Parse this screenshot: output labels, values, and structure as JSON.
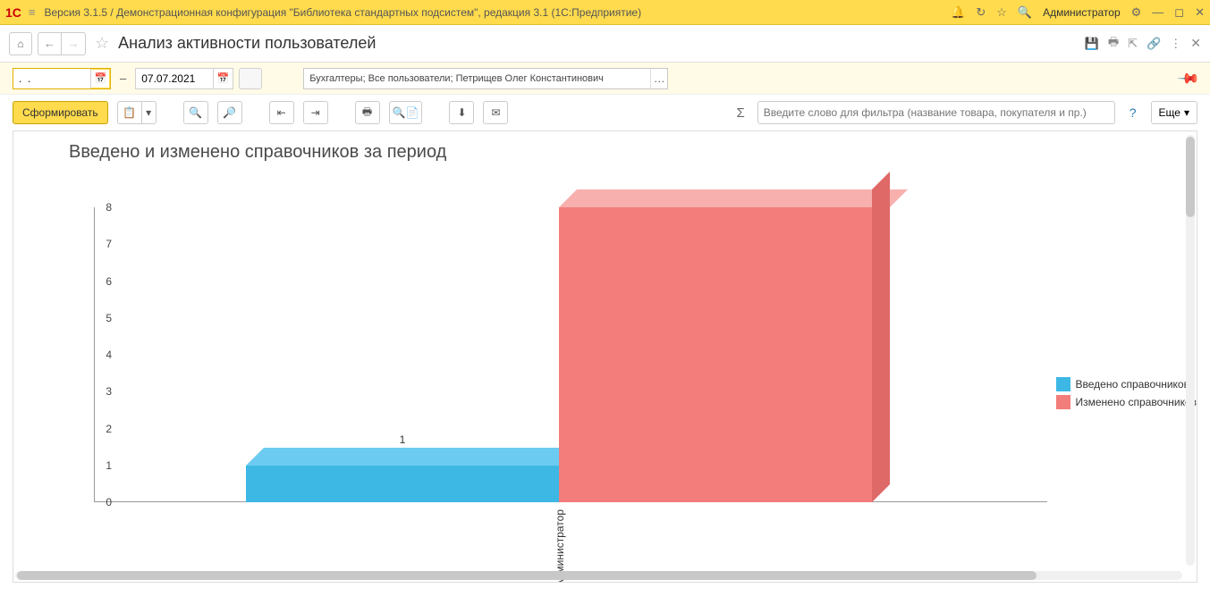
{
  "appbar": {
    "logo": "1С",
    "title": "Версия 3.1.5 / Демонстрационная конфигурация \"Библиотека стандартных подсистем\", редакция 3.1  (1С:Предприятие)",
    "user": "Администратор"
  },
  "page": {
    "title": "Анализ активности пользователей"
  },
  "filter": {
    "date_from": ".  .",
    "date_to": "07.07.2021",
    "dash": "–",
    "users": "Бухгалтеры; Все пользователи; Петрищев Олег Константинович"
  },
  "toolbar": {
    "generate": "Сформировать",
    "filter_placeholder": "Введите слово для фильтра (название товара, покупателя и пр.)",
    "more": "Еще",
    "help": "?"
  },
  "chart_data": {
    "type": "bar",
    "title": "Введено и изменено справочников за период",
    "categories": [
      "Администратор"
    ],
    "series": [
      {
        "name": "Введено справочников",
        "values": [
          1
        ],
        "color": "#3db8e5",
        "colorTop": "#6ccbf0",
        "colorSide": "#2aa4d1"
      },
      {
        "name": "Изменено справочников",
        "values": [
          8
        ],
        "color": "#f27d7a",
        "colorTop": "#f7b0ad",
        "colorSide": "#de6966"
      }
    ],
    "ylim": [
      0,
      8
    ],
    "yticks": [
      0,
      1,
      2,
      3,
      4,
      5,
      6,
      7,
      8
    ]
  }
}
